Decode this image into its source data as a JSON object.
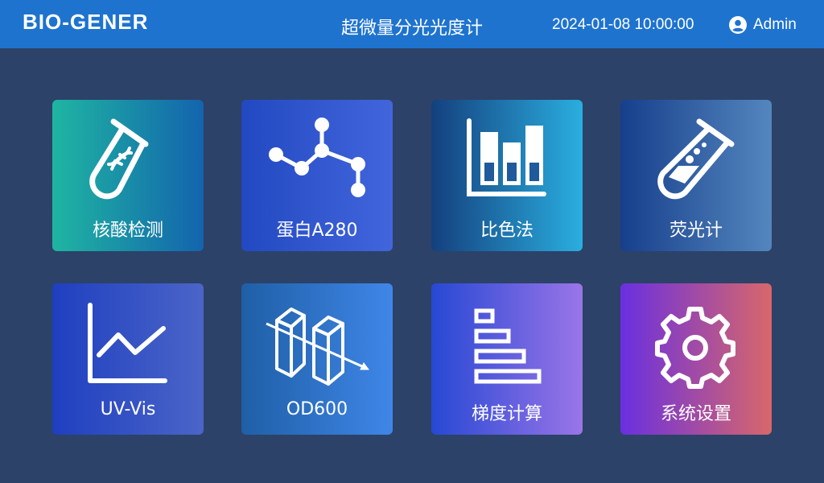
{
  "header": {
    "logo": "BIO-GENER",
    "title": "超微量分光光度计",
    "datetime": "2024-01-08 10:00:00",
    "user": "Admin"
  },
  "tiles": [
    {
      "label": "核酸检测",
      "icon": "test-tube-dna-icon"
    },
    {
      "label": "蛋白A280",
      "icon": "molecule-icon"
    },
    {
      "label": "比色法",
      "icon": "bar-chart-icon"
    },
    {
      "label": "荧光计",
      "icon": "flask-icon"
    },
    {
      "label": "UV-Vis",
      "icon": "line-chart-icon"
    },
    {
      "label": "OD600",
      "icon": "cuvette-icon"
    },
    {
      "label": "梯度计算",
      "icon": "gradient-bars-icon"
    },
    {
      "label": "系统设置",
      "icon": "gear-icon"
    }
  ],
  "colors": {
    "background": "#2c4268",
    "header": "#1e73cf"
  }
}
